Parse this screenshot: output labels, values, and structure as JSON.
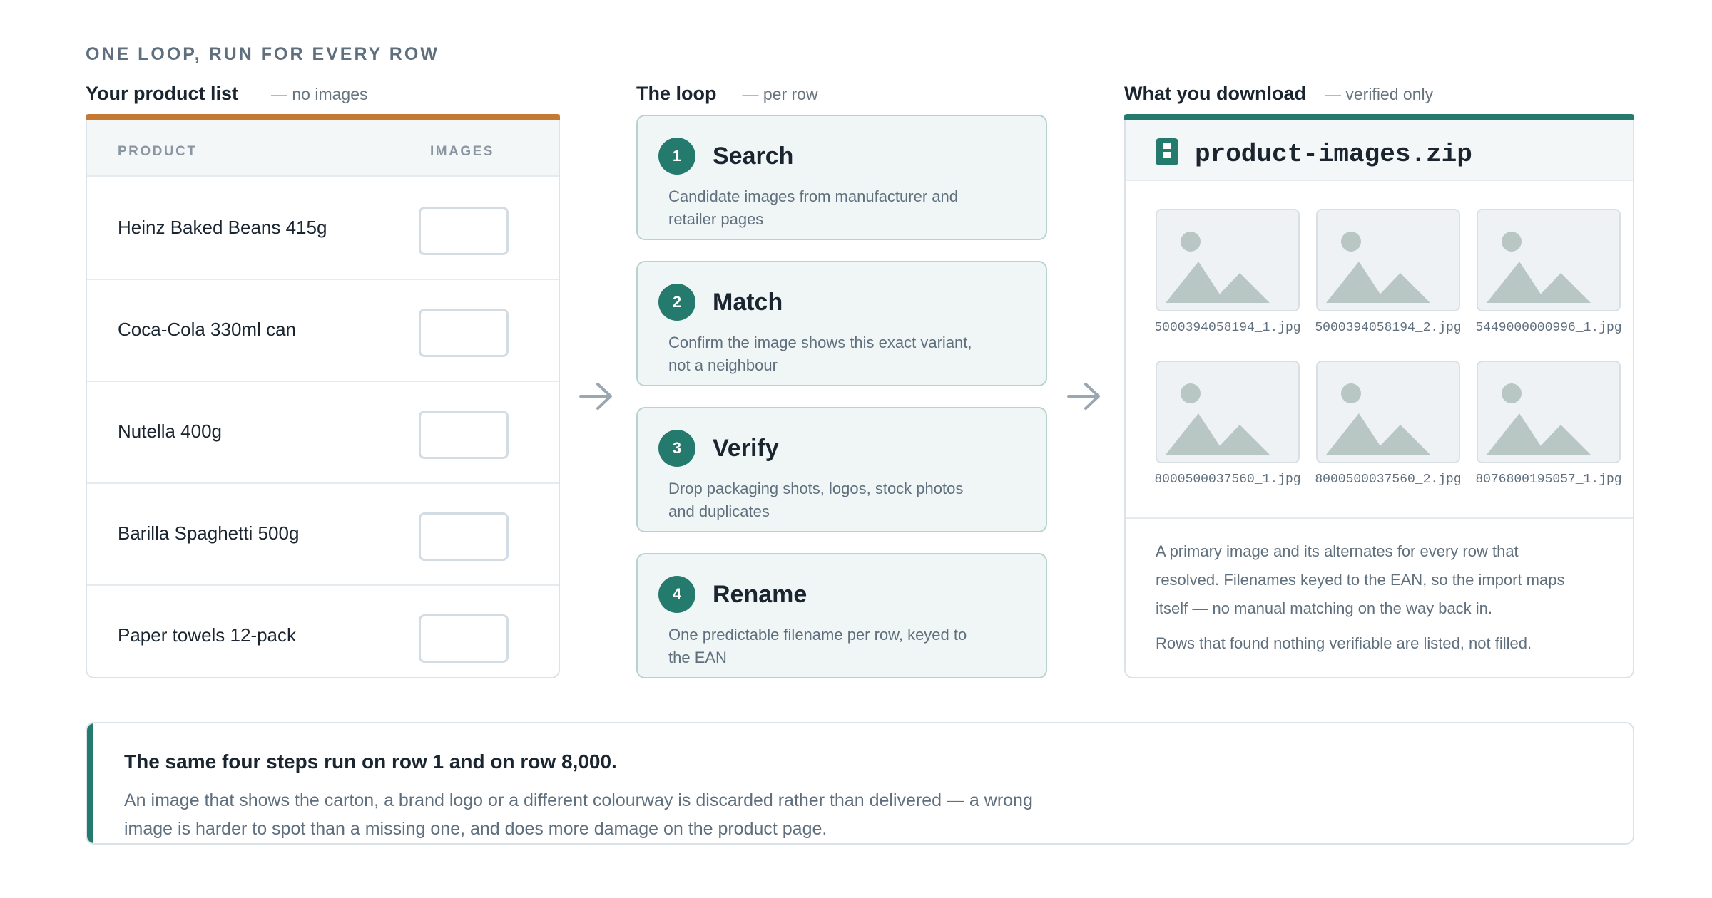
{
  "eyebrow": "ONE LOOP, RUN FOR EVERY ROW",
  "product_list": {
    "title": "Your product list",
    "subtitle": "— no images",
    "col_product": "PRODUCT",
    "col_images": "IMAGES",
    "rows": [
      {
        "name": "Heinz Baked Beans 415g"
      },
      {
        "name": "Coca-Cola 330ml can"
      },
      {
        "name": "Nutella 400g"
      },
      {
        "name": "Barilla Spaghetti 500g"
      },
      {
        "name": "Paper towels 12-pack"
      }
    ]
  },
  "loop": {
    "title": "The loop",
    "subtitle": "— per row",
    "steps": [
      {
        "num": "1",
        "title": "Search",
        "desc": "Candidate images from manufacturer and retailer pages"
      },
      {
        "num": "2",
        "title": "Match",
        "desc": "Confirm the image shows this exact variant, not a neighbour"
      },
      {
        "num": "3",
        "title": "Verify",
        "desc": "Drop packaging shots, logos, stock photos and duplicates"
      },
      {
        "num": "4",
        "title": "Rename",
        "desc": "One predictable filename per row, keyed to the EAN"
      }
    ]
  },
  "download": {
    "title": "What you download",
    "subtitle": "— verified only",
    "zip_name": "product-images.zip",
    "files": [
      "5000394058194_1.jpg",
      "5000394058194_2.jpg",
      "5449000000996_1.jpg",
      "8000500037560_1.jpg",
      "8000500037560_2.jpg",
      "8076800195057_1.jpg"
    ],
    "body1": "A primary image and its alternates for every row that resolved. Filenames keyed to the EAN, so the import maps itself — no manual matching on the way back in.",
    "body2": "Rows that found nothing verifiable are listed, not filled."
  },
  "note": {
    "heading": "The same four steps run on row 1 and on row 8,000.",
    "body": "An image that shows the carton, a brand logo or a different colourway is discarded rather than delivered — a wrong image is harder to spot than a missing one, and does more damage on the product page."
  },
  "colors": {
    "accent_orange": "#c47a34",
    "accent_teal": "#257a6e",
    "step_fill": "#f0f6f6",
    "step_border": "#b7d3d1",
    "muted_text": "#5f6f7d"
  },
  "icons": {
    "flow_arrow": "arrow-right-icon",
    "zip": "zip-file-icon",
    "thumbnail": "image-placeholder-icon"
  }
}
